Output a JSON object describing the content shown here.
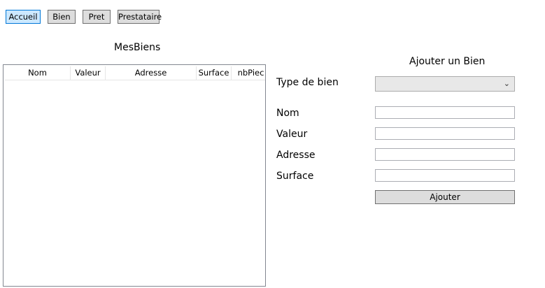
{
  "nav": {
    "accueil": "Accueil",
    "bien": "Bien",
    "pret": "Pret",
    "prestataire": "Prestataire"
  },
  "list": {
    "title": "MesBiens",
    "columns": [
      "Nom",
      "Valeur",
      "Adresse",
      "Surface",
      "nbPiec"
    ],
    "rows": []
  },
  "form": {
    "title": "Ajouter un Bien",
    "type_label": "Type de bien",
    "type_selected": "",
    "nom_label": "Nom",
    "nom_value": "",
    "valeur_label": "Valeur",
    "valeur_value": "",
    "adresse_label": "Adresse",
    "adresse_value": "",
    "surface_label": "Surface",
    "surface_value": "",
    "submit_label": "Ajouter"
  },
  "colors": {
    "active_nav": "#cce8ff",
    "active_nav_border": "#0078d7",
    "button_bg": "#dddddd"
  }
}
